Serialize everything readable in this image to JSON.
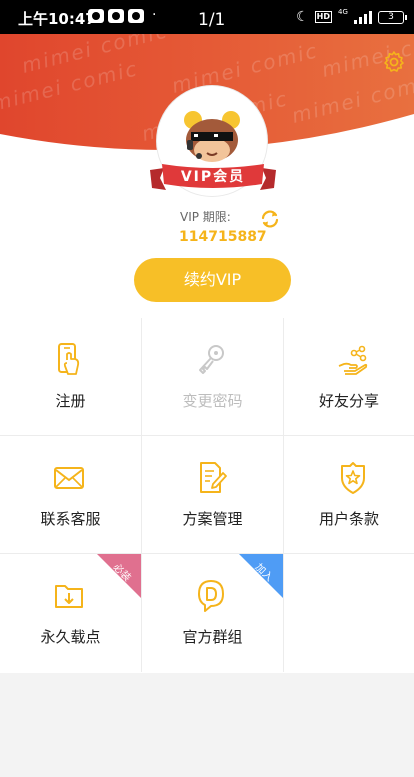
{
  "status_bar": {
    "time": "上午10:47",
    "page_indicator": "1/1",
    "network_label": "4G",
    "hd_label": "HD",
    "battery_level": "3",
    "dot": "·"
  },
  "header": {
    "watermark_text": "mimei comic",
    "vip_ribbon_label": "VIP会员",
    "vip_expiry_label": "VIP 期限:",
    "vip_number": "114715887",
    "renew_button_label": "续约VIP"
  },
  "colors": {
    "banner_orange": "#e55a36",
    "accent_yellow": "#f7bf27",
    "ribbon_red": "#e0393a",
    "badge_pink": "#e0708f",
    "badge_blue": "#4f9cf5"
  },
  "menu": {
    "items": [
      {
        "label": "注册",
        "icon": "phone-touch-icon",
        "enabled": true
      },
      {
        "label": "变更密码",
        "icon": "key-icon",
        "enabled": false
      },
      {
        "label": "好友分享",
        "icon": "share-hand-icon",
        "enabled": true
      },
      {
        "label": "联系客服",
        "icon": "envelope-icon",
        "enabled": true
      },
      {
        "label": "方案管理",
        "icon": "document-edit-icon",
        "enabled": true
      },
      {
        "label": "用户条款",
        "icon": "shield-star-icon",
        "enabled": true
      },
      {
        "label": "永久载点",
        "icon": "folder-download-icon",
        "enabled": true,
        "badge": "必装"
      },
      {
        "label": "官方群组",
        "icon": "chat-d-icon",
        "enabled": true,
        "badge": "加入"
      }
    ]
  }
}
